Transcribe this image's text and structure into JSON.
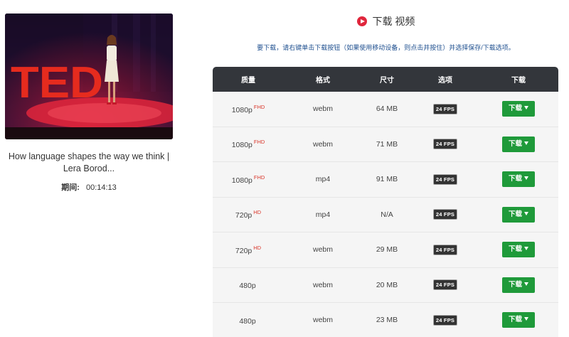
{
  "video": {
    "title": "How language shapes the way we think | Lera Borod...",
    "duration_label": "期间:",
    "duration_value": "00:14:13",
    "thumbnail_text": "TED"
  },
  "header": {
    "title": "下载 视频",
    "instructions": "要下载，请右键单击下载按钮（如果使用移动设备，则点击并按住）并选择保存/下载选项。"
  },
  "table": {
    "columns": [
      "质量",
      "格式",
      "尺寸",
      "选项",
      "下载"
    ],
    "rows": [
      {
        "quality": "1080p",
        "badge": "FHD",
        "format": "webm",
        "size": "64 MB",
        "fps": "24 FPS",
        "button": "下载"
      },
      {
        "quality": "1080p",
        "badge": "FHD",
        "format": "webm",
        "size": "71 MB",
        "fps": "24 FPS",
        "button": "下载"
      },
      {
        "quality": "1080p",
        "badge": "FHD",
        "format": "mp4",
        "size": "91 MB",
        "fps": "24 FPS",
        "button": "下载"
      },
      {
        "quality": "720p",
        "badge": "HD",
        "format": "mp4",
        "size": "N/A",
        "fps": "24 FPS",
        "button": "下载"
      },
      {
        "quality": "720p",
        "badge": "HD",
        "format": "webm",
        "size": "29 MB",
        "fps": "24 FPS",
        "button": "下载"
      },
      {
        "quality": "480p",
        "badge": "",
        "format": "webm",
        "size": "20 MB",
        "fps": "24 FPS",
        "button": "下载"
      },
      {
        "quality": "480p",
        "badge": "",
        "format": "webm",
        "size": "23 MB",
        "fps": "24 FPS",
        "button": "下载"
      }
    ]
  },
  "colors": {
    "header_bg": "#33363b",
    "button_green": "#1f9a3a",
    "badge_red": "#d9362a",
    "ted_red": "#e62b1e"
  }
}
